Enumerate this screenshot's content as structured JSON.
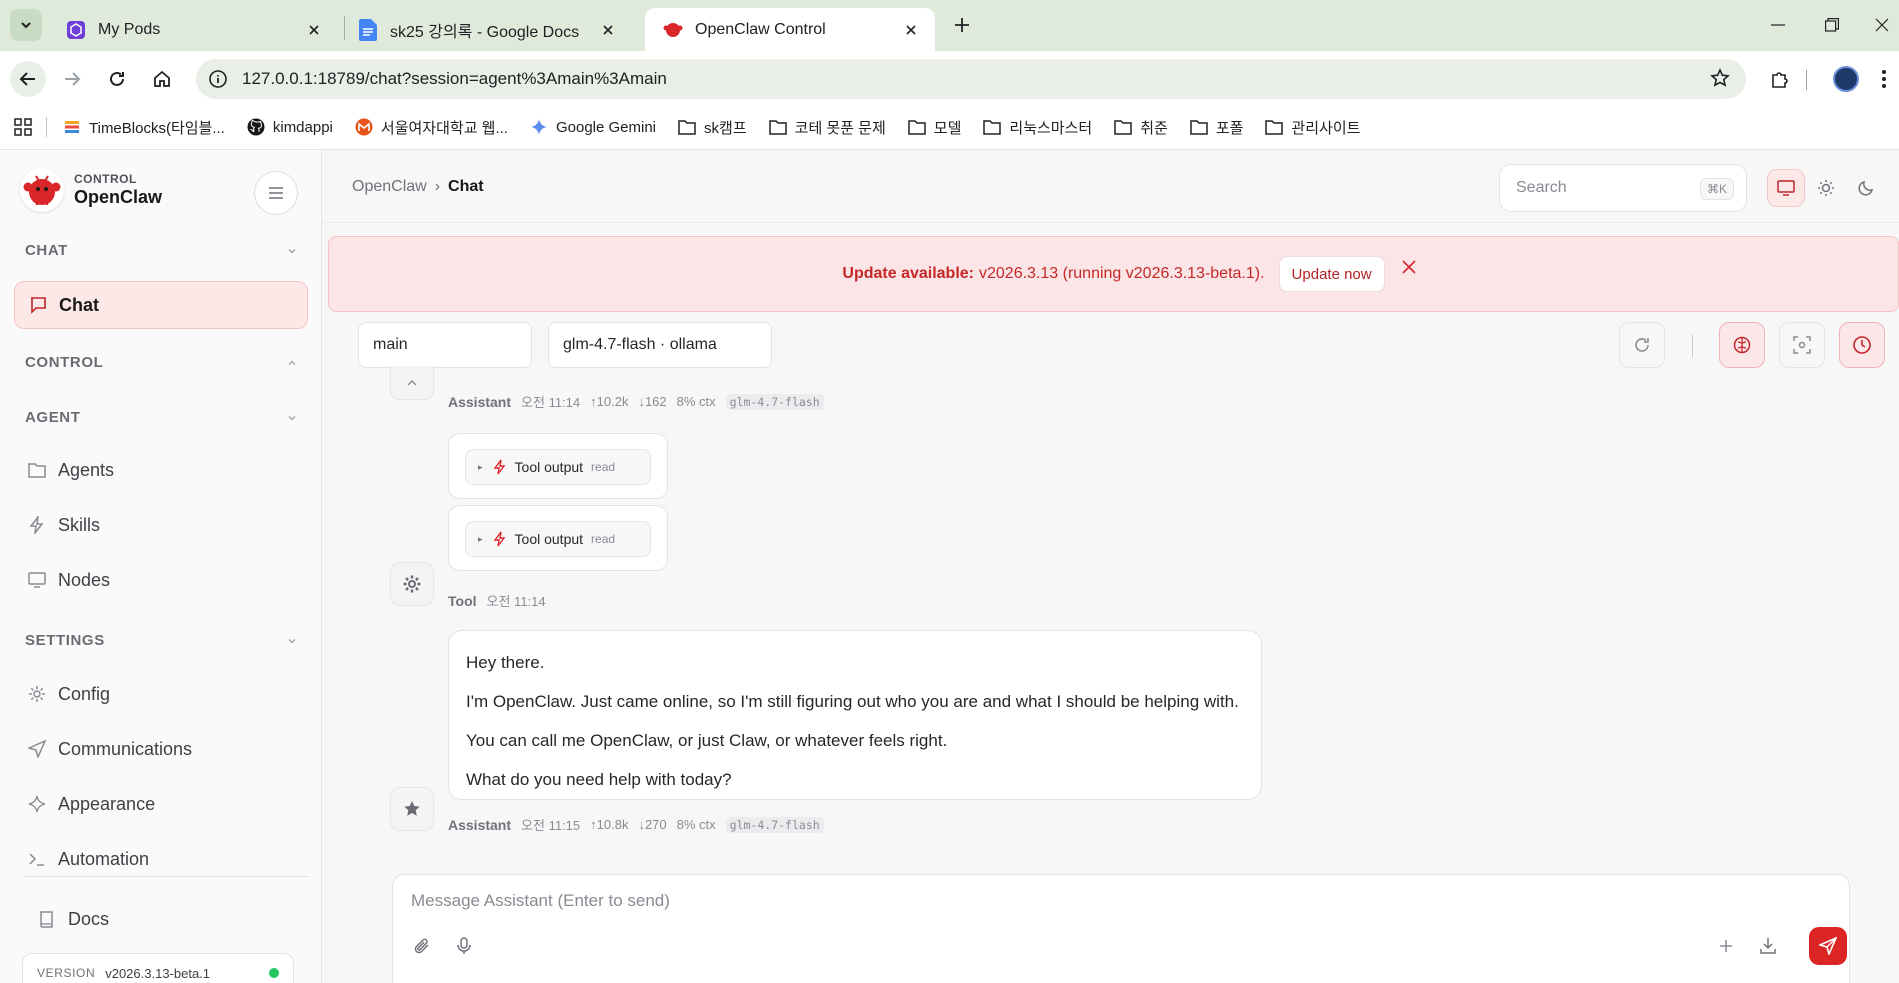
{
  "browser": {
    "tabs": [
      {
        "title": "My Pods",
        "icon": "pods-icon"
      },
      {
        "title": "sk25 강의록 - Google Docs",
        "icon": "google-docs-icon"
      },
      {
        "title": "OpenClaw Control",
        "icon": "openclaw-icon"
      }
    ],
    "url": "127.0.0.1:18789/chat?session=agent%3Amain%3Amain",
    "bookmarks": [
      "TimeBlocks(타임블...",
      "kimdappi",
      "서울여자대학교 웹...",
      "Google Gemini",
      "sk캠프",
      "코테 못푼 문제",
      "모델",
      "리눅스마스터",
      "취준",
      "포폴",
      "관리사이트"
    ]
  },
  "sidebar": {
    "brand_sub": "CONTROL",
    "brand_name": "OpenClaw",
    "sections": {
      "chat": "CHAT",
      "control": "CONTROL",
      "agent": "AGENT",
      "settings": "SETTINGS"
    },
    "items": {
      "chat": "Chat",
      "agents": "Agents",
      "skills": "Skills",
      "nodes": "Nodes",
      "config": "Config",
      "communications": "Communications",
      "appearance": "Appearance",
      "automation": "Automation",
      "docs": "Docs"
    },
    "version_label": "VERSION",
    "version": "v2026.3.13-beta.1"
  },
  "header": {
    "breadcrumb_root": "OpenClaw",
    "breadcrumb_sep": "›",
    "breadcrumb_current": "Chat",
    "search_placeholder": "Search",
    "search_shortcut": "⌘K"
  },
  "banner": {
    "label": "Update available:",
    "text": "v2026.3.13 (running v2026.3.13-beta.1).",
    "button": "Update now"
  },
  "session": {
    "agent": "main",
    "model": "glm-4.7-flash · ollama"
  },
  "messages": {
    "first_meta": {
      "who": "Assistant",
      "time": "오전 11:14",
      "in": "↑10.2k",
      "out": "↓162",
      "ctx": "8% ctx",
      "model": "glm-4.7-flash"
    },
    "tool_outputs": [
      {
        "label": "Tool output",
        "tag": "read"
      },
      {
        "label": "Tool output",
        "tag": "read"
      }
    ],
    "tool_meta": {
      "who": "Tool",
      "time": "오전 11:14"
    },
    "reply_lines": [
      "Hey there.",
      "I'm OpenClaw. Just came online, so I'm still figuring out who you are and what I should be helping with.",
      "You can call me OpenClaw, or just Claw, or whatever feels right.",
      "What do you need help with today?"
    ],
    "reply_meta": {
      "who": "Assistant",
      "time": "오전 11:15",
      "in": "↑10.8k",
      "out": "↓270",
      "ctx": "8% ctx",
      "model": "glm-4.7-flash"
    }
  },
  "composer": {
    "placeholder": "Message Assistant (Enter to send)"
  },
  "colors": {
    "accent": "#dc2626",
    "accent_soft": "#fde8e8",
    "banner_text": "#c62828",
    "online": "#22c55e"
  }
}
